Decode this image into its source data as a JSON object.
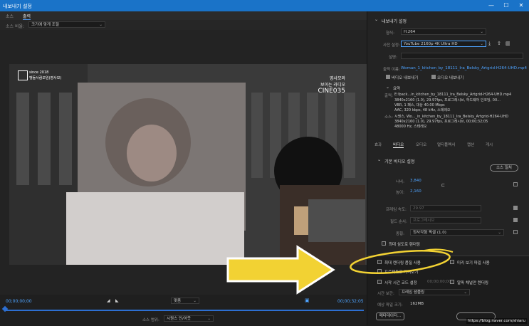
{
  "window": {
    "title": "내보내기 설정",
    "min": "—",
    "max": "☐",
    "close": "✕"
  },
  "left": {
    "tabs": [
      "소스",
      "출력"
    ],
    "source_scaling_label": "소스 비율:",
    "source_scaling_value": "크기에 맞게 조절",
    "video_text": {
      "logo_line1": "since 2018",
      "logo_line2": "맹돌사람모임(영사모)",
      "cine_line1": "영사모와",
      "cine_line2": "보이는 라디오",
      "cine_big": "CINE035"
    },
    "timeline": {
      "start_tc": "00;00;00;00",
      "end_tc": "00;00;32;05",
      "fit": "맞춤",
      "source_range_label": "소스 범위:",
      "source_range_value": "시퀀스 인/아웃"
    }
  },
  "right": {
    "export_settings_title": "내보내기 설정",
    "format_label": "형식:",
    "format_value": "H.264",
    "preset_label": "사전 설정:",
    "preset_value": "YouTube 2160p 4K Ultra HD",
    "comments_label": "설명:",
    "output_name_label": "출력 이름:",
    "output_name_value": "Woman_1_kitchen_by_18111_Ira_Belsky_Artgrid-H264-UHD.mp4",
    "export_video": "비디오 내보내기",
    "export_audio": "오디오 내보내기",
    "summary_title": "요약",
    "summary_output_label": "출력:",
    "summary_output_lines": [
      "E:\\back...in_kitchen_by_18111_Ira_Belsky_Artgrid-H264-UHD.mp4",
      "3840x2160 (1.0), 29.97fps, 프로그레시브, 하드웨어 인코딩, 00...",
      "VBR, 1 패스, 대상 40.00 Mbps",
      "AAC, 320 kbps, 48 kHz, 스테레오"
    ],
    "summary_source_label": "소스:",
    "summary_source_lines": [
      "시퀀스, Wo..._in_kitchen_by_18111_Ira_Belsky_Artgrid-H264-UHD",
      "3840x2160 (1.0), 29.97fps, 프로그레시브, 00;00;32;05",
      "48000 Hz, 스테레오"
    ],
    "tabs": [
      "효과",
      "비디오",
      "오디오",
      "멀티플렉서",
      "캡션",
      "게시"
    ],
    "basic_video_title": "기본 비디오 설정",
    "match_source_button": "소스 일치",
    "width_label": "너비:",
    "width_value": "3,840",
    "height_label": "높이:",
    "height_value": "2,160",
    "frame_rate_label": "프레임 속도:",
    "frame_rate_value": "29.97",
    "field_order_label": "필드 순서:",
    "field_order_value": "프로그레시브",
    "aspect_label": "종횡:",
    "aspect_value": "정사각형 픽셀 (1.0)",
    "max_depth": "최대 심도로 렌더링",
    "max_render_quality": "최대 렌더링 품질 사용",
    "use_previews": "미리 보기 파일 사용",
    "import_into_project": "프로젝트로 가져오기",
    "set_start_tc": "시작 시간 코드 설정",
    "start_tc_value": "00;00;00;00",
    "render_alpha": "알파 채널만 렌더링",
    "time_interp_label": "시간 보간:",
    "time_interp_value": "프레임 샘플링",
    "file_size_label": "예상 파일 크기:",
    "file_size_value": "162MB",
    "metadata_button": "메타데이터...",
    "watermark": "https://blog.naver.com/shiaru"
  }
}
